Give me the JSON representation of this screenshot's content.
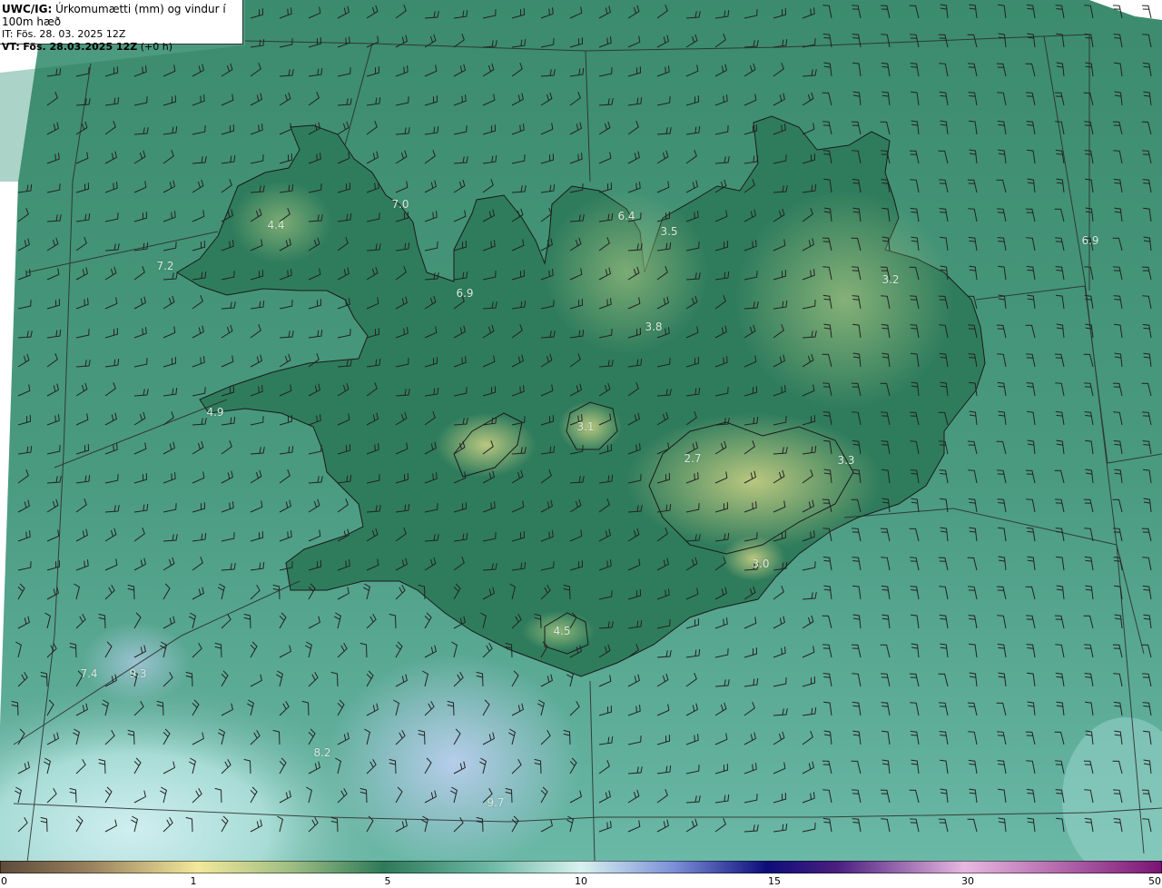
{
  "header": {
    "model_label": "UWC/IG:",
    "title_text": "Úrkomumætti (mm) og vindur í 100m hæð",
    "initial_time": "IT: Fös. 28. 03. 2025 12Z",
    "valid_label": "VT:",
    "valid_time": "Fös. 28.03.2025 12Z",
    "valid_offset": "(+0 h)"
  },
  "value_labels": [
    "4.4",
    "7.0",
    "7.2",
    "6.9",
    "6.4",
    "3.5",
    "3.8",
    "3.2",
    "6.9",
    "4.9",
    "3.1",
    "2.7",
    "3.3",
    "3.0",
    "4.5",
    "7.4",
    "9.3",
    "8.2",
    "9.7"
  ],
  "colorbar": {
    "ticks": [
      "0",
      "1",
      "5",
      "10",
      "15",
      "30",
      "50"
    ]
  },
  "colors": {
    "sea_green": "#3f8f74",
    "land_dark": "#2f7a5a",
    "land_light": "#b6c67e",
    "wet_light": "#c9ecef",
    "wet_blue": "#b2cdea",
    "coast_line": "#1a1a1a",
    "barb_color": "#222222"
  }
}
